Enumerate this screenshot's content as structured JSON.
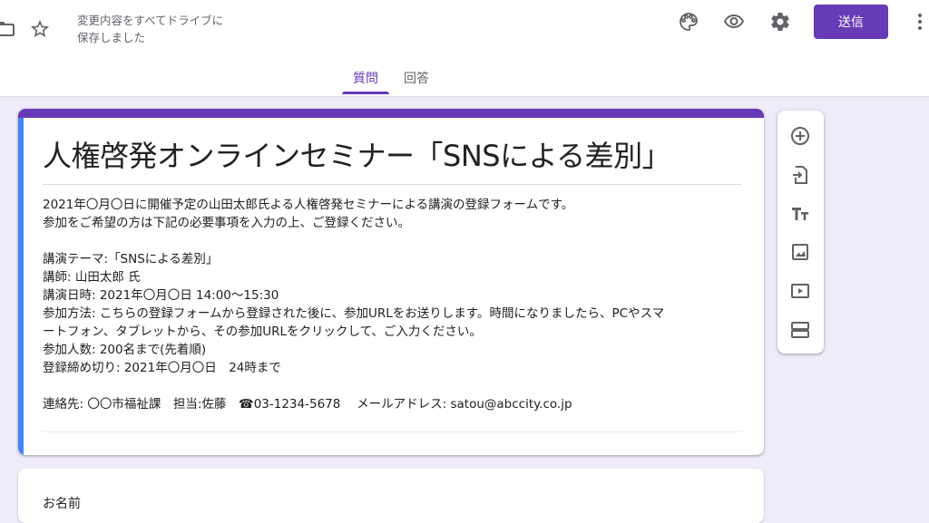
{
  "header": {
    "save_status": "変更内容をすべてドライブに\n保存しました",
    "send_label": "送信"
  },
  "tabs": [
    {
      "label": "質問",
      "active": true
    },
    {
      "label": "回答",
      "active": false
    }
  ],
  "icons": {
    "folder": "folder-icon",
    "star": "star-icon",
    "palette": "palette-icon",
    "preview": "eye-icon",
    "settings": "gear-icon",
    "more": "more-vert-icon"
  },
  "colors": {
    "accent": "#673ab7",
    "background": "#f0ebf8",
    "active_section": "#4285f4"
  },
  "form": {
    "title": "人権啓発オンラインセミナー「SNSによる差別」",
    "description": {
      "line1": "2021年〇月〇日に開催予定の山田太郎氏よる人権啓発セミナーによる講演の登録フォームです。",
      "line2": "参加をご希望の方は下記の必要事項を入力の上、ご登録ください。",
      "theme": "講演テーマ:「SNSによる差別」",
      "lecturer": "講師: 山田太郎 氏",
      "datetime": "講演日時: 2021年〇月〇日 14:00～15:30",
      "method1": "参加方法: こちらの登録フォームから登録された後に、参加URLをお送りします。時間になりましたら、PCやスマ",
      "method2": "ートフォン、タブレットから、その参加URLをクリックして、ご入力ください。",
      "capacity": "参加人数: 200名まで(先着順)",
      "deadline": "登録締め切り: 2021年〇月〇日　24時まで",
      "contact": "連絡先: 〇〇市福祉課　担当:佐藤　☎03-1234-5678　 メールアドレス: satou@abccity.co.jp"
    }
  },
  "side_toolbar": [
    {
      "name": "add-question-icon"
    },
    {
      "name": "import-questions-icon"
    },
    {
      "name": "add-title-icon"
    },
    {
      "name": "add-image-icon"
    },
    {
      "name": "add-video-icon"
    },
    {
      "name": "add-section-icon"
    }
  ],
  "next_card": {
    "title": "お名前"
  }
}
